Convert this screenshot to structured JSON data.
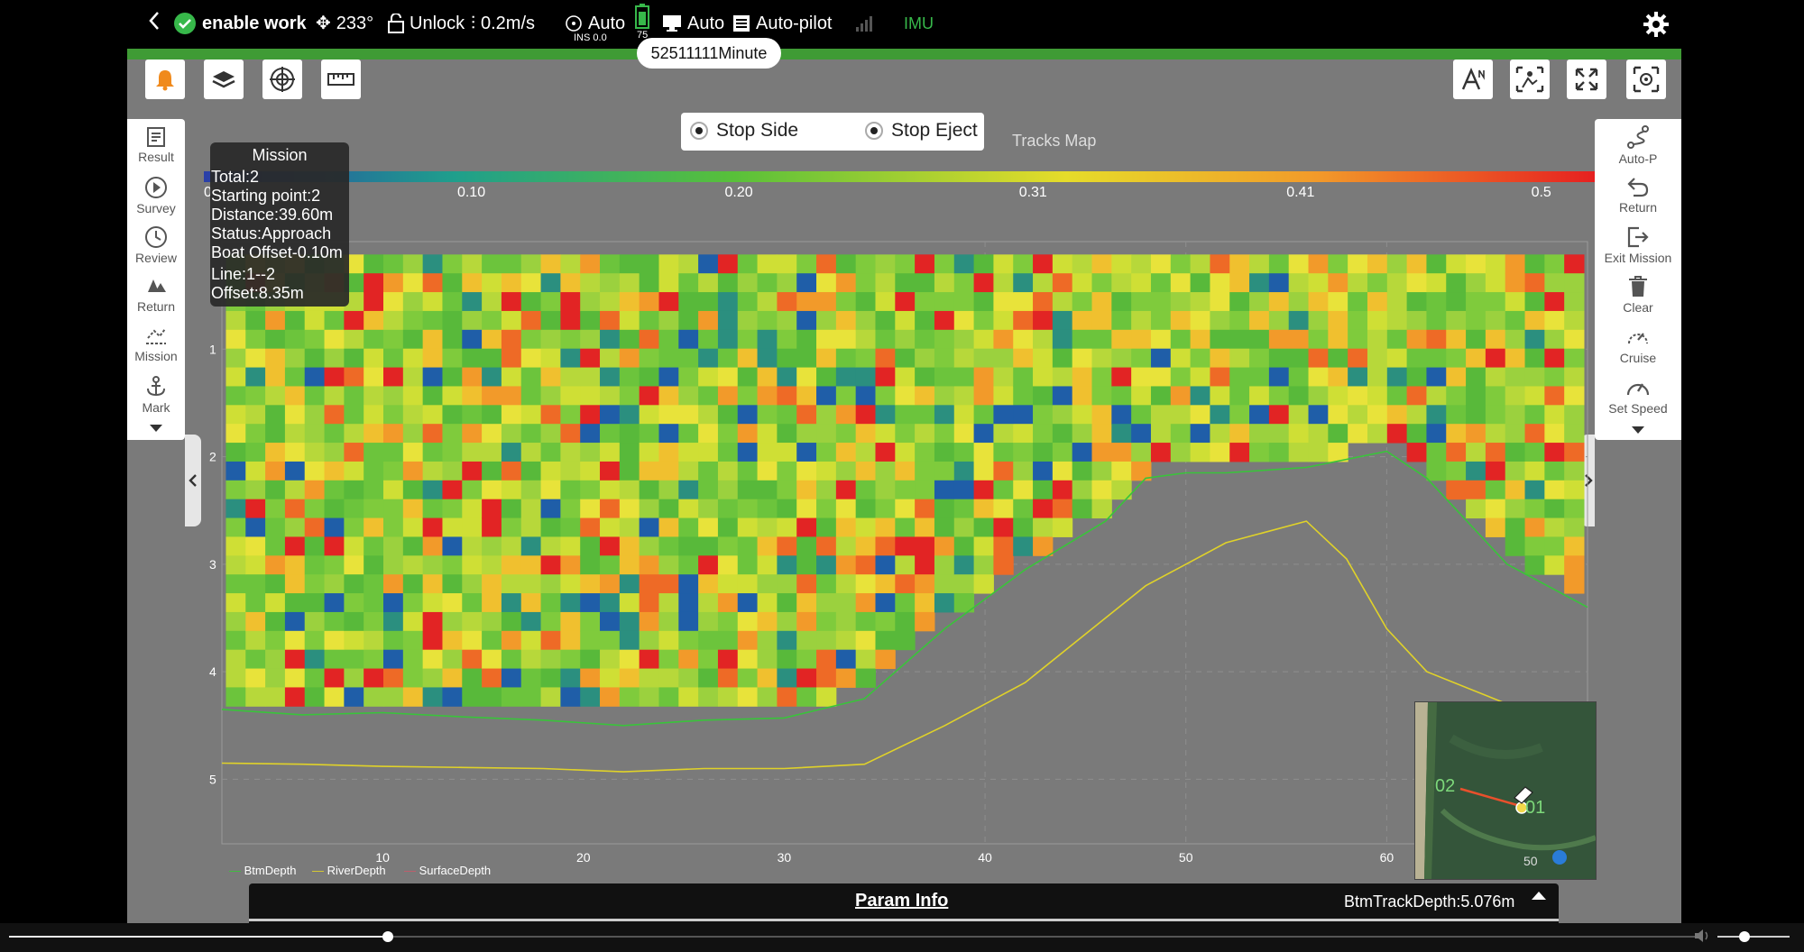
{
  "status_bar": {
    "enable_work": "enable work",
    "heading": "233°",
    "lock": "Unlock",
    "speed": "0.2m/s",
    "nav_mode": "Auto",
    "ins": "INS 0.0",
    "battery": "75",
    "remote_mode": "Auto",
    "autopilot": "Auto-pilot",
    "imu": "IMU",
    "duration_badge": "52511111Minute"
  },
  "toolbar_left": [
    "bell-icon",
    "layers-icon",
    "compass-icon",
    "ruler-icon"
  ],
  "toolbar_right": [
    "auto-text-icon",
    "map-toggle-icon",
    "fullscreen-icon",
    "locate-icon"
  ],
  "left_menu": [
    "Result",
    "Survey",
    "Review",
    "Return",
    "Mission",
    "Mark"
  ],
  "right_menu": [
    "Auto-P",
    "Return",
    "Exit Mission",
    "Clear",
    "Cruise",
    "Set Speed"
  ],
  "options": {
    "stop_side": "Stop Side",
    "stop_eject": "Stop Eject",
    "tracks_map": "Tracks Map"
  },
  "mission": {
    "title": "Mission",
    "lines": [
      "Total:2",
      "Starting point:2",
      "Distance:39.60m",
      "Status:Approach",
      "Boat Offset-0.10m",
      "Line:1--2",
      "Offset:8.35m"
    ]
  },
  "chart_data": {
    "type": "heatmap",
    "colorbar": {
      "ticks": [
        "0",
        "0.10",
        "0.20",
        "0.31",
        "0.41",
        "0.5"
      ],
      "range": [
        0,
        0.52
      ]
    },
    "x_ticks": [
      "10",
      "20",
      "30",
      "40",
      "50",
      "60"
    ],
    "y_ticks": [
      "1",
      "2",
      "3",
      "4",
      "5"
    ],
    "xlim": [
      2,
      70
    ],
    "ylim": [
      0,
      5.6
    ],
    "series": [
      {
        "name": "BtmDepth",
        "color": "#39c43a",
        "x": [
          2,
          6,
          10,
          14,
          18,
          22,
          26,
          30,
          34,
          38,
          42,
          46,
          48,
          50,
          52,
          56,
          60,
          62,
          66,
          70
        ],
        "y": [
          4.35,
          4.4,
          4.38,
          4.42,
          4.45,
          4.5,
          4.45,
          4.43,
          4.25,
          3.6,
          3.05,
          2.6,
          2.2,
          2.15,
          2.15,
          2.1,
          1.95,
          2.2,
          3.0,
          3.4
        ]
      },
      {
        "name": "RiverDepth",
        "color": "#e0d229",
        "x": [
          2,
          6,
          10,
          14,
          18,
          22,
          26,
          30,
          34,
          38,
          42,
          46,
          48,
          50,
          52,
          56,
          58,
          60,
          62,
          66,
          70
        ],
        "y": [
          4.85,
          4.86,
          4.88,
          4.89,
          4.9,
          4.93,
          4.9,
          4.9,
          4.86,
          4.5,
          4.1,
          3.5,
          3.2,
          3.0,
          2.8,
          2.6,
          2.95,
          3.6,
          4.0,
          4.3,
          4.4
        ]
      },
      {
        "name": "SurfaceDepth",
        "color": "#c65a6a",
        "x": [],
        "y": []
      }
    ]
  },
  "minimap": {
    "label_start": "02",
    "label_end": "01",
    "scale": "50"
  },
  "param_info": {
    "title": "Param Info",
    "value": "BtmTrackDepth:5.076m"
  }
}
